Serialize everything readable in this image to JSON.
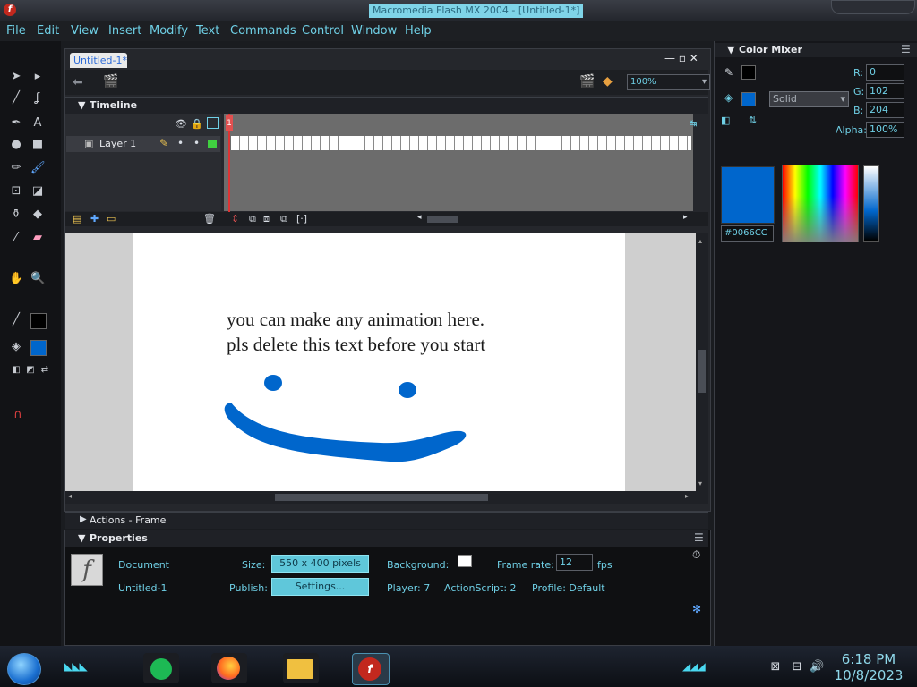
{
  "window": {
    "title": "Macromedia Flash MX 2004 - [Untitled-1*]"
  },
  "menu": [
    "File",
    "Edit",
    "View",
    "Insert",
    "Modify",
    "Text",
    "Commands",
    "Control",
    "Window",
    "Help"
  ],
  "document": {
    "tab_label": "Untitled-1*",
    "zoom": "100%"
  },
  "timeline": {
    "title": "Timeline",
    "layer_name": "Layer 1",
    "current_frame": "1"
  },
  "stage": {
    "text_line1": "you can make any animation here.",
    "text_line2": "pls delete this text before you start",
    "drawing_color": "#0066CC",
    "background": "#ffffff"
  },
  "actions": {
    "title": "Actions - Frame"
  },
  "properties": {
    "title": "Properties",
    "doc_type": "Document",
    "doc_name": "Untitled-1",
    "size_label": "Size:",
    "size_value": "550 x 400 pixels",
    "publish_label": "Publish:",
    "settings_button": "Settings...",
    "background_label": "Background:",
    "frame_rate_label": "Frame rate:",
    "frame_rate_value": "12",
    "fps_label": "fps",
    "player_label": "Player: 7",
    "actionscript_label": "ActionScript: 2",
    "profile_label": "Profile: Default"
  },
  "color_mixer": {
    "title": "Color Mixer",
    "r_label": "R:",
    "r_value": "0",
    "g_label": "G:",
    "g_value": "102",
    "b_label": "B:",
    "b_value": "204",
    "alpha_label": "Alpha:",
    "alpha_value": "100%",
    "fill_type": "Solid",
    "hex": "#0066CC"
  },
  "taskbar": {
    "time": "6:18 PM",
    "date": "10/8/2023"
  }
}
